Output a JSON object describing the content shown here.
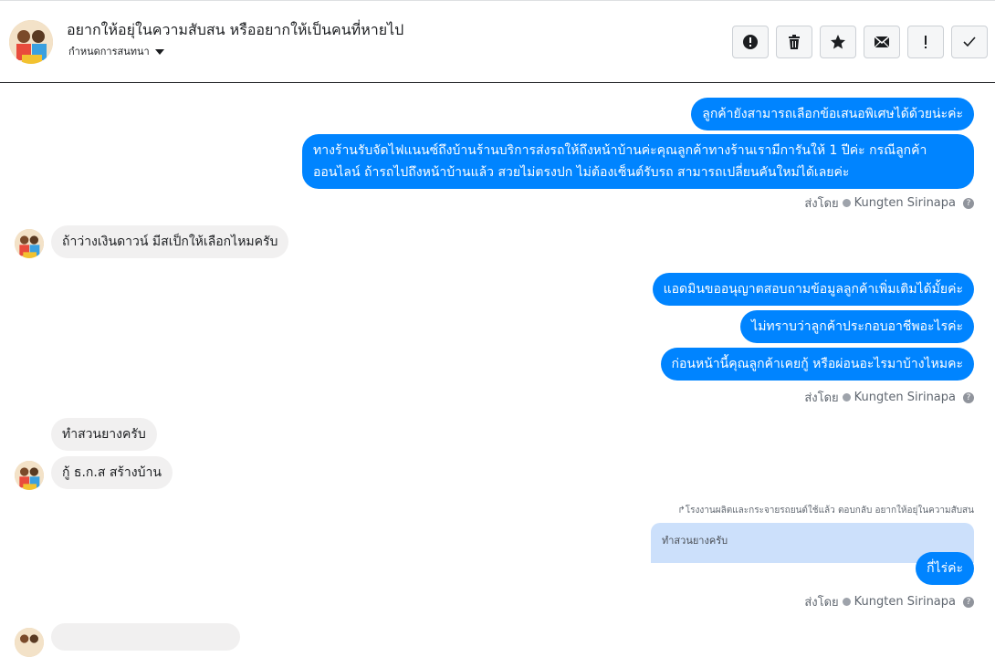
{
  "header": {
    "title": "อยากให้อยุ่ในความสับสน หรืออยากให้เป็นคนที่หายไป",
    "subtitle": "กำหนดการสนทนา"
  },
  "actions": [
    {
      "name": "report-icon",
      "label": "!"
    },
    {
      "name": "trash-icon"
    },
    {
      "name": "star-icon"
    },
    {
      "name": "mail-icon"
    },
    {
      "name": "exclaim-icon",
      "label": "!"
    },
    {
      "name": "check-icon"
    }
  ],
  "messages": {
    "m1": "ลูกค้ายังสามารถเลือกข้อเสนอพิเศษได้ด้วยน่ะค่ะ",
    "m2_line1": "ทางร้านรับจัดไฟแนนซ์ถึงบ้านร้านบริการส่งรถให้ถึงหน้าบ้านค่ะคุณลูกค้าทางร้านเรามีการันให้ 1 ปีค่ะ กรณีลูกค้า",
    "m2_line2": "ออนไลน์ ถ้ารถไปถึงหน้าบ้านแล้ว สวยไม่ตรงปก ไม่ต้องเซ็นต์รับรถ สามารถเปลี่ยนคันใหม่ได้เลยค่ะ",
    "in1": "ถ้าว่างเงินดาวน์ มีสเป็กให้เลือกไหมครับ",
    "m3": "แอดมินขออนุญาตสอบถามข้อมูลลูกค้าเพิ่มเติมได้มั้ยค่ะ",
    "m4": "ไม่ทราบว่าลูกค้าประกอบอาชีพอะไรค่ะ",
    "m5": "ก่อนหน้านี้คุณลูกค้าเคยกู้ หรือผ่อนอะไรมาบ้างไหมคะ",
    "in2": "ทำสวนยางครับ",
    "in3": "กู้ ธ.ก.ส สร้างบ้าน",
    "reply_note": "↱โรงงานผลิตและกระจายรถยนต์ใช้แล้ว ตอบกลับ อยากให้อยุ่ในความสับสน",
    "quoted": "ทำสวนยางครับ",
    "m6": "กี่ไร่ค่ะ"
  },
  "sent_by": {
    "prefix": "ส่งโดย",
    "name": "Kungten Sirinapa",
    "help": "?"
  },
  "colors": {
    "outgoing": "#0084ff",
    "incoming": "#f1f0f0",
    "quote": "#cce0fb"
  }
}
